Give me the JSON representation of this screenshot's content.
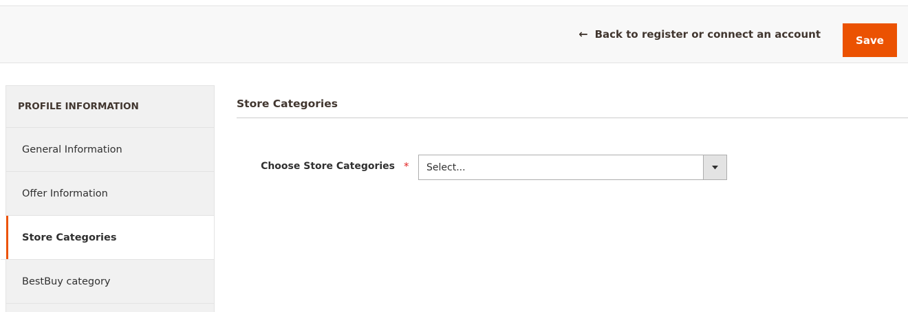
{
  "header": {
    "back_arrow": "←",
    "back_label": "Back to register or connect an account",
    "save_label": "Save"
  },
  "sidebar": {
    "title": "PROFILE INFORMATION",
    "items": [
      {
        "label": "General Information",
        "active": false
      },
      {
        "label": "Offer Information",
        "active": false
      },
      {
        "label": "Store Categories",
        "active": true
      },
      {
        "label": "BestBuy category",
        "active": false
      }
    ]
  },
  "main": {
    "section_title": "Store Categories",
    "field": {
      "label": "Choose Store Categories",
      "required_marker": "*",
      "selected_value": "Select...",
      "toggle_icon": "chevron-down-icon"
    }
  },
  "colors": {
    "accent": "#eb5202",
    "required": "#e22626"
  }
}
